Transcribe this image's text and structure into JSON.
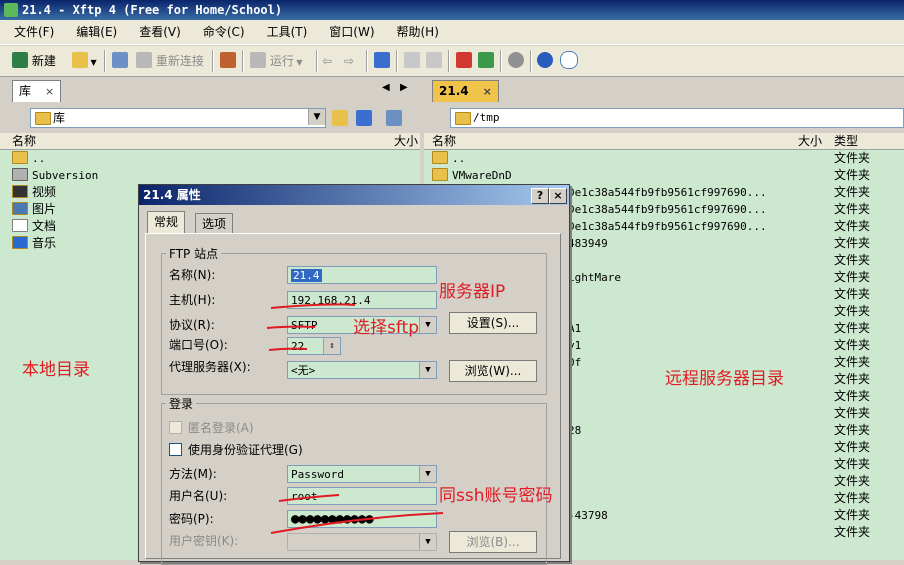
{
  "window": {
    "title": "21.4 - Xftp 4 (Free for Home/School)"
  },
  "menu": [
    "文件(F)",
    "编辑(E)",
    "查看(V)",
    "命令(C)",
    "工具(T)",
    "窗口(W)",
    "帮助(H)"
  ],
  "toolbar": {
    "new": "新建",
    "reconnect": "重新连接",
    "run": "运行"
  },
  "left": {
    "tab": "库",
    "tab_close": "×",
    "path": "库",
    "col_name": "名称",
    "col_size": "大小",
    "items": [
      "..",
      "Subversion",
      "视频",
      "图片",
      "文档",
      "音乐"
    ]
  },
  "right": {
    "tab": "21.4",
    "tab_close": "×",
    "path": "/tmp",
    "col_name": "名称",
    "col_size": "大小",
    "col_type": "类型",
    "items": [
      "..",
      "VMwareDnD"
    ],
    "partial": [
      "De1c38a544fb9fb9561cf997690...",
      "De1c38a544fb9fb9561cf997690...",
      "De1c38a544fb9fb9561cf997690...",
      "483949",
      "ightMare",
      "A1",
      "y1",
      "0f",
      "28",
      "-43798"
    ],
    "type_label": "文件夹"
  },
  "annotations": {
    "local": "本地目录",
    "remote": "远程服务器目录",
    "server_ip": "服务器IP",
    "choose_sftp": "选择sftp",
    "same_ssh": "同ssh账号密码"
  },
  "dialog": {
    "title": "21.4 属性",
    "help": "?",
    "close": "×",
    "tabs": [
      "常规",
      "选项"
    ],
    "ftp_group": "FTP 站点",
    "name_label": "名称(N):",
    "name_value": "21.4",
    "host_label": "主机(H):",
    "host_value": "192.168.21.4",
    "protocol_label": "协议(R):",
    "protocol_value": "SFTP",
    "settings_button": "设置(S)...",
    "port_label": "端口号(O):",
    "port_value": "22",
    "proxy_label": "代理服务器(X):",
    "proxy_value": "<无>",
    "browse_button": "浏览(W)...",
    "login_group": "登录",
    "anonymous_label": "匿名登录(A)",
    "agent_label": "使用身份验证代理(G)",
    "method_label": "方法(M):",
    "method_value": "Password",
    "user_label": "用户名(U):",
    "user_value": "root",
    "password_label": "密码(P):",
    "password_value": "●●●●●●●●●●●",
    "userkey_label": "用户密钥(K):",
    "userkey_browse": "浏览(B)..."
  }
}
